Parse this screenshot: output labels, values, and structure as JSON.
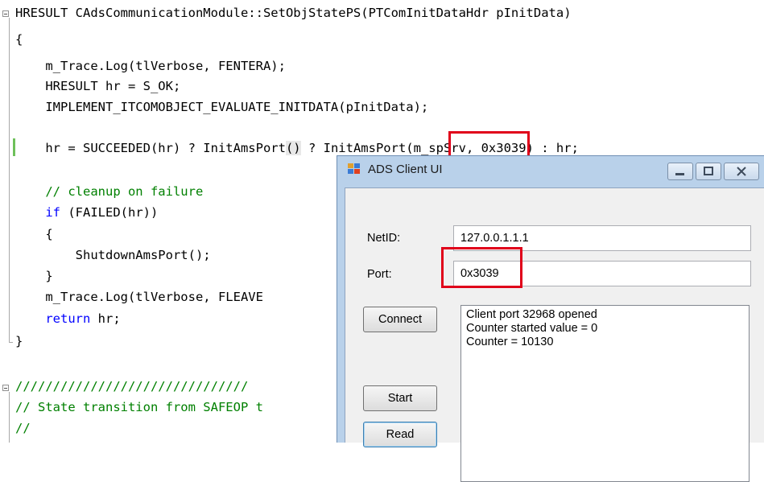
{
  "editor": {
    "code_lines": [
      "HRESULT CAdsCommunicationModule::SetObjStatePS(PTComInitDataHdr pInitData)",
      "{",
      "    m_Trace.Log(tlVerbose, FENTERA);",
      "    HRESULT hr = S_OK;",
      "    IMPLEMENT_ITCOMOBJECT_EVALUATE_INITDATA(pInitData);",
      "    hr = SUCCEEDED(hr) ? InitAmsPort(m_spSrv, 0x3039) : hr;",
      "    // cleanup on failure",
      "    if (FAILED(hr))",
      "    {",
      "        ShutdownAmsPort();",
      "    }",
      "    m_Trace.Log(tlVerbose, FLEAVE",
      "    return hr;",
      "}",
      "///////////////////////////////",
      "// State transition from SAFEOP t",
      "//"
    ],
    "highlighted_port": "0x3039"
  },
  "dialog": {
    "title": "ADS Client UI",
    "netid_label": "NetID:",
    "netid_value": "127.0.0.1.1.1",
    "port_label": "Port:",
    "port_value": "0x3039",
    "connect_label": "Connect",
    "start_label": "Start",
    "read_label": "Read",
    "log_lines": [
      "Client port 32968 opened",
      "Counter started value = 0",
      "Counter = 10130"
    ]
  },
  "colors": {
    "annotation_red": "#e0001a",
    "keyword_blue": "#0000ff",
    "comment_green": "#008000"
  }
}
